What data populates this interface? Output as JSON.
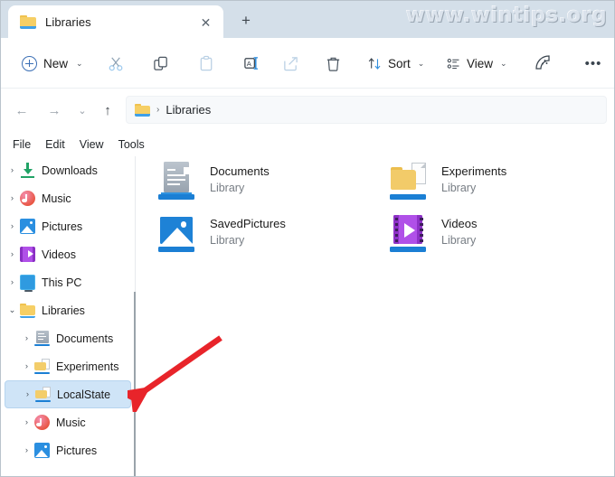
{
  "window": {
    "watermark": "www.wintips.org"
  },
  "tabs": {
    "active": {
      "title": "Libraries",
      "icon": "folder-icon"
    },
    "close_label": "✕",
    "new_tab_label": "+"
  },
  "toolbar": {
    "new_label": "New",
    "new_chevron": "⌄",
    "items": [
      {
        "name": "cut",
        "icon": "scissors-icon"
      },
      {
        "name": "copy",
        "icon": "copy-icon"
      },
      {
        "name": "paste",
        "icon": "paste-icon"
      },
      {
        "name": "rename",
        "icon": "rename-icon"
      },
      {
        "name": "share",
        "icon": "share-icon"
      },
      {
        "name": "delete",
        "icon": "trash-icon"
      }
    ],
    "sort_label": "Sort",
    "sort_chevron": "⌄",
    "view_label": "View",
    "view_chevron": "⌄",
    "filter_icon": "filter-slice-icon",
    "overflow_label": "•••"
  },
  "addressbar": {
    "back": "←",
    "forward": "→",
    "recent": "⌄",
    "up": "↑",
    "breadcrumb_separator": "›",
    "path": "Libraries"
  },
  "menubar": {
    "items": [
      "File",
      "Edit",
      "View",
      "Tools"
    ]
  },
  "sidebar": {
    "items": [
      {
        "label": "Downloads",
        "icon": "download-icon",
        "expander": "›",
        "indent": 0,
        "selected": false
      },
      {
        "label": "Music",
        "icon": "music-icon",
        "expander": "›",
        "indent": 0,
        "selected": false
      },
      {
        "label": "Pictures",
        "icon": "pictures-icon",
        "expander": "›",
        "indent": 0,
        "selected": false
      },
      {
        "label": "Videos",
        "icon": "videos-icon",
        "expander": "›",
        "indent": 0,
        "selected": false
      },
      {
        "label": "This PC",
        "icon": "this-pc-icon",
        "expander": "›",
        "indent": 0,
        "selected": false
      },
      {
        "label": "Libraries",
        "icon": "folder-icon",
        "expander": "⌄",
        "indent": 0,
        "selected": false
      },
      {
        "label": "Documents",
        "icon": "documents-library-icon",
        "expander": "›",
        "indent": 1,
        "selected": false
      },
      {
        "label": "Experiments",
        "icon": "folder-library-icon",
        "expander": "›",
        "indent": 1,
        "selected": false
      },
      {
        "label": "LocalState",
        "icon": "folder-library-icon",
        "expander": "›",
        "indent": 1,
        "selected": true
      },
      {
        "label": "Music",
        "icon": "music-icon",
        "expander": "›",
        "indent": 1,
        "selected": false
      },
      {
        "label": "Pictures",
        "icon": "pictures-icon",
        "expander": "›",
        "indent": 1,
        "selected": false
      }
    ]
  },
  "content": {
    "libraries": [
      {
        "name": "Documents",
        "sub": "Library",
        "icon": "documents-library-icon"
      },
      {
        "name": "Experiments",
        "sub": "Library",
        "icon": "folder-library-icon"
      },
      {
        "name": "SavedPictures",
        "sub": "Library",
        "icon": "pictures-library-icon"
      },
      {
        "name": "Videos",
        "sub": "Library",
        "icon": "videos-library-icon"
      }
    ]
  },
  "annotation": {
    "arrow_color": "#e8242a",
    "points_to": "LocalState"
  },
  "colors": {
    "tabstrip_bg": "#d4dfe9",
    "selection_bg": "#cfe4f7",
    "accent": "#1b7fd4",
    "arrow_red": "#e8242a"
  }
}
